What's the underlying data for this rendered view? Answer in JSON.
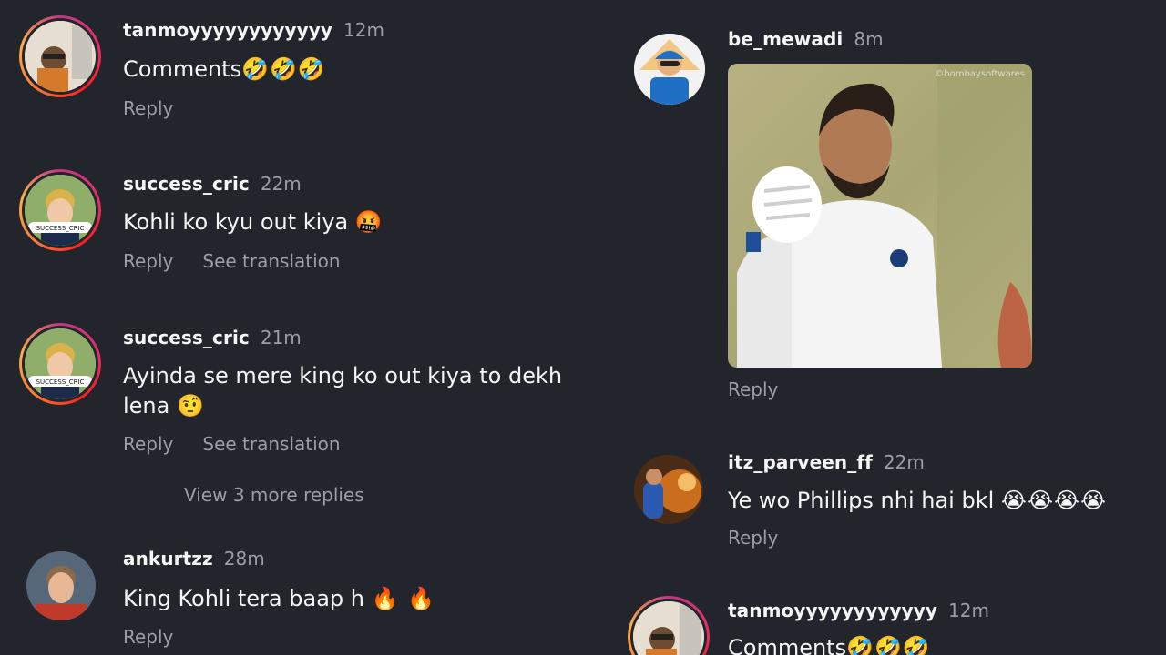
{
  "left_comments": [
    {
      "username": "tanmoyyyyyyyyyyyy",
      "time": "12m",
      "text": "Comments",
      "emoji": "🤣🤣🤣",
      "reply": "Reply"
    },
    {
      "username": "success_cric",
      "time": "22m",
      "text": "Kohli ko kyu out kiya",
      "emoji": "🤬",
      "reply": "Reply",
      "see_translation": "See translation"
    },
    {
      "username": "success_cric",
      "time": "21m",
      "text": "Ayinda se mere king ko out kiya to dekh lena",
      "emoji": "🤨",
      "reply": "Reply",
      "see_translation": "See translation",
      "view_more": "View 3 more replies"
    },
    {
      "username": "ankurtzz",
      "time": "28m",
      "text": "King Kohli tera baap h",
      "emoji": "🔥 🔥",
      "reply": "Reply"
    }
  ],
  "right_comments": [
    {
      "username": "be_mewadi",
      "time": "8m",
      "gif_watermark": "©bombaysoftwares",
      "reply": "Reply"
    },
    {
      "username": "itz_parveen_ff",
      "time": "22m",
      "text": "Ye wo Phillips nhi hai bkl",
      "emoji": "😭😭😭😭",
      "reply": "Reply"
    },
    {
      "username": "tanmoyyyyyyyyyyyy",
      "time": "12m",
      "text": "Comments",
      "emoji": "🤣🤣🤣"
    }
  ],
  "colors": {
    "background": "#22252b",
    "username": "#f5f5f5",
    "secondary": "#9a9ea5",
    "story_ring": "#e1306c"
  }
}
